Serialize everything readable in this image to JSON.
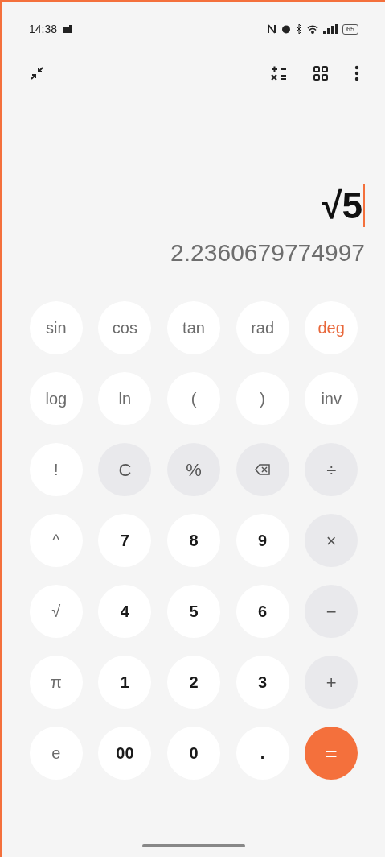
{
  "status_bar": {
    "time": "14:38",
    "battery": "65"
  },
  "display": {
    "expression": "√5",
    "result": "2.2360679774997"
  },
  "keys": [
    {
      "label": "sin",
      "kind": "function"
    },
    {
      "label": "cos",
      "kind": "function"
    },
    {
      "label": "tan",
      "kind": "function"
    },
    {
      "label": "rad",
      "kind": "mode",
      "selected": false
    },
    {
      "label": "deg",
      "kind": "mode",
      "selected": true
    },
    {
      "label": "log",
      "kind": "function"
    },
    {
      "label": "ln",
      "kind": "function"
    },
    {
      "label": "(",
      "kind": "function"
    },
    {
      "label": ")",
      "kind": "function"
    },
    {
      "label": "inv",
      "kind": "function"
    },
    {
      "label": "!",
      "kind": "function"
    },
    {
      "label": "C",
      "kind": "operator"
    },
    {
      "label": "%",
      "kind": "operator"
    },
    {
      "kind": "backspace"
    },
    {
      "label": "÷",
      "kind": "operator"
    },
    {
      "label": "^",
      "kind": "function"
    },
    {
      "label": "7",
      "kind": "digit"
    },
    {
      "label": "8",
      "kind": "digit"
    },
    {
      "label": "9",
      "kind": "digit"
    },
    {
      "label": "×",
      "kind": "operator"
    },
    {
      "label": "√",
      "kind": "function"
    },
    {
      "label": "4",
      "kind": "digit"
    },
    {
      "label": "5",
      "kind": "digit"
    },
    {
      "label": "6",
      "kind": "digit"
    },
    {
      "label": "−",
      "kind": "operator"
    },
    {
      "label": "π",
      "kind": "function"
    },
    {
      "label": "1",
      "kind": "digit"
    },
    {
      "label": "2",
      "kind": "digit"
    },
    {
      "label": "3",
      "kind": "digit"
    },
    {
      "label": "+",
      "kind": "operator"
    },
    {
      "label": "e",
      "kind": "function"
    },
    {
      "label": "00",
      "kind": "digit"
    },
    {
      "label": "0",
      "kind": "digit"
    },
    {
      "label": ".",
      "kind": "digit"
    },
    {
      "label": "=",
      "kind": "equals"
    }
  ]
}
